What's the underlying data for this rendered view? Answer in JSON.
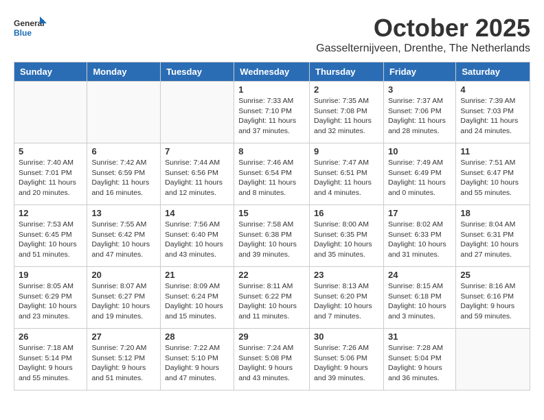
{
  "header": {
    "logo_general": "General",
    "logo_blue": "Blue",
    "month": "October 2025",
    "location": "Gasselternijveen, Drenthe, The Netherlands"
  },
  "weekdays": [
    "Sunday",
    "Monday",
    "Tuesday",
    "Wednesday",
    "Thursday",
    "Friday",
    "Saturday"
  ],
  "weeks": [
    [
      {
        "day": "",
        "info": ""
      },
      {
        "day": "",
        "info": ""
      },
      {
        "day": "",
        "info": ""
      },
      {
        "day": "1",
        "info": "Sunrise: 7:33 AM\nSunset: 7:10 PM\nDaylight: 11 hours\nand 37 minutes."
      },
      {
        "day": "2",
        "info": "Sunrise: 7:35 AM\nSunset: 7:08 PM\nDaylight: 11 hours\nand 32 minutes."
      },
      {
        "day": "3",
        "info": "Sunrise: 7:37 AM\nSunset: 7:06 PM\nDaylight: 11 hours\nand 28 minutes."
      },
      {
        "day": "4",
        "info": "Sunrise: 7:39 AM\nSunset: 7:03 PM\nDaylight: 11 hours\nand 24 minutes."
      }
    ],
    [
      {
        "day": "5",
        "info": "Sunrise: 7:40 AM\nSunset: 7:01 PM\nDaylight: 11 hours\nand 20 minutes."
      },
      {
        "day": "6",
        "info": "Sunrise: 7:42 AM\nSunset: 6:59 PM\nDaylight: 11 hours\nand 16 minutes."
      },
      {
        "day": "7",
        "info": "Sunrise: 7:44 AM\nSunset: 6:56 PM\nDaylight: 11 hours\nand 12 minutes."
      },
      {
        "day": "8",
        "info": "Sunrise: 7:46 AM\nSunset: 6:54 PM\nDaylight: 11 hours\nand 8 minutes."
      },
      {
        "day": "9",
        "info": "Sunrise: 7:47 AM\nSunset: 6:51 PM\nDaylight: 11 hours\nand 4 minutes."
      },
      {
        "day": "10",
        "info": "Sunrise: 7:49 AM\nSunset: 6:49 PM\nDaylight: 11 hours\nand 0 minutes."
      },
      {
        "day": "11",
        "info": "Sunrise: 7:51 AM\nSunset: 6:47 PM\nDaylight: 10 hours\nand 55 minutes."
      }
    ],
    [
      {
        "day": "12",
        "info": "Sunrise: 7:53 AM\nSunset: 6:45 PM\nDaylight: 10 hours\nand 51 minutes."
      },
      {
        "day": "13",
        "info": "Sunrise: 7:55 AM\nSunset: 6:42 PM\nDaylight: 10 hours\nand 47 minutes."
      },
      {
        "day": "14",
        "info": "Sunrise: 7:56 AM\nSunset: 6:40 PM\nDaylight: 10 hours\nand 43 minutes."
      },
      {
        "day": "15",
        "info": "Sunrise: 7:58 AM\nSunset: 6:38 PM\nDaylight: 10 hours\nand 39 minutes."
      },
      {
        "day": "16",
        "info": "Sunrise: 8:00 AM\nSunset: 6:35 PM\nDaylight: 10 hours\nand 35 minutes."
      },
      {
        "day": "17",
        "info": "Sunrise: 8:02 AM\nSunset: 6:33 PM\nDaylight: 10 hours\nand 31 minutes."
      },
      {
        "day": "18",
        "info": "Sunrise: 8:04 AM\nSunset: 6:31 PM\nDaylight: 10 hours\nand 27 minutes."
      }
    ],
    [
      {
        "day": "19",
        "info": "Sunrise: 8:05 AM\nSunset: 6:29 PM\nDaylight: 10 hours\nand 23 minutes."
      },
      {
        "day": "20",
        "info": "Sunrise: 8:07 AM\nSunset: 6:27 PM\nDaylight: 10 hours\nand 19 minutes."
      },
      {
        "day": "21",
        "info": "Sunrise: 8:09 AM\nSunset: 6:24 PM\nDaylight: 10 hours\nand 15 minutes."
      },
      {
        "day": "22",
        "info": "Sunrise: 8:11 AM\nSunset: 6:22 PM\nDaylight: 10 hours\nand 11 minutes."
      },
      {
        "day": "23",
        "info": "Sunrise: 8:13 AM\nSunset: 6:20 PM\nDaylight: 10 hours\nand 7 minutes."
      },
      {
        "day": "24",
        "info": "Sunrise: 8:15 AM\nSunset: 6:18 PM\nDaylight: 10 hours\nand 3 minutes."
      },
      {
        "day": "25",
        "info": "Sunrise: 8:16 AM\nSunset: 6:16 PM\nDaylight: 9 hours\nand 59 minutes."
      }
    ],
    [
      {
        "day": "26",
        "info": "Sunrise: 7:18 AM\nSunset: 5:14 PM\nDaylight: 9 hours\nand 55 minutes."
      },
      {
        "day": "27",
        "info": "Sunrise: 7:20 AM\nSunset: 5:12 PM\nDaylight: 9 hours\nand 51 minutes."
      },
      {
        "day": "28",
        "info": "Sunrise: 7:22 AM\nSunset: 5:10 PM\nDaylight: 9 hours\nand 47 minutes."
      },
      {
        "day": "29",
        "info": "Sunrise: 7:24 AM\nSunset: 5:08 PM\nDaylight: 9 hours\nand 43 minutes."
      },
      {
        "day": "30",
        "info": "Sunrise: 7:26 AM\nSunset: 5:06 PM\nDaylight: 9 hours\nand 39 minutes."
      },
      {
        "day": "31",
        "info": "Sunrise: 7:28 AM\nSunset: 5:04 PM\nDaylight: 9 hours\nand 36 minutes."
      },
      {
        "day": "",
        "info": ""
      }
    ]
  ]
}
